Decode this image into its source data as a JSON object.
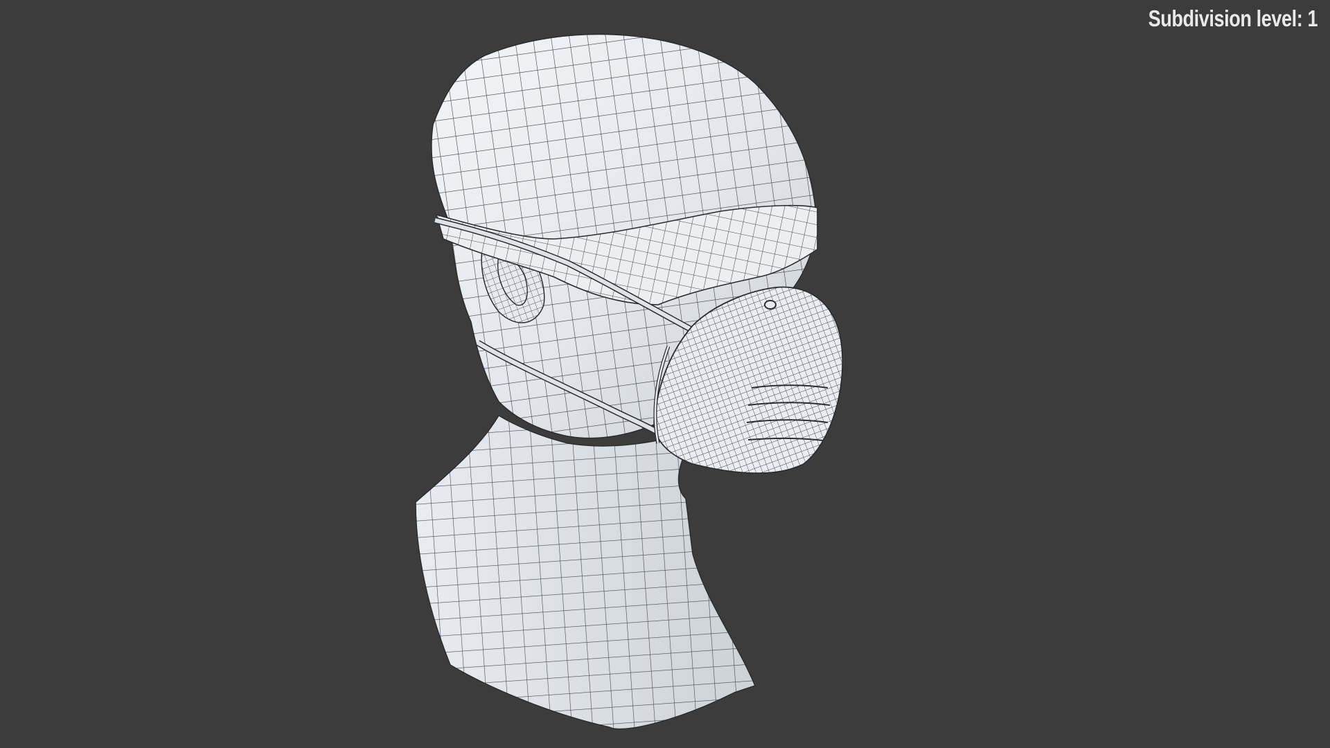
{
  "viewport": {
    "overlay_text": "Subdivision level: 1",
    "background_color": "#3c3c3c",
    "model": {
      "subject": "wireframe-head-with-respirator-mask",
      "surface_color": "#e4e8ec",
      "wire_color": "#2a2d30"
    }
  }
}
